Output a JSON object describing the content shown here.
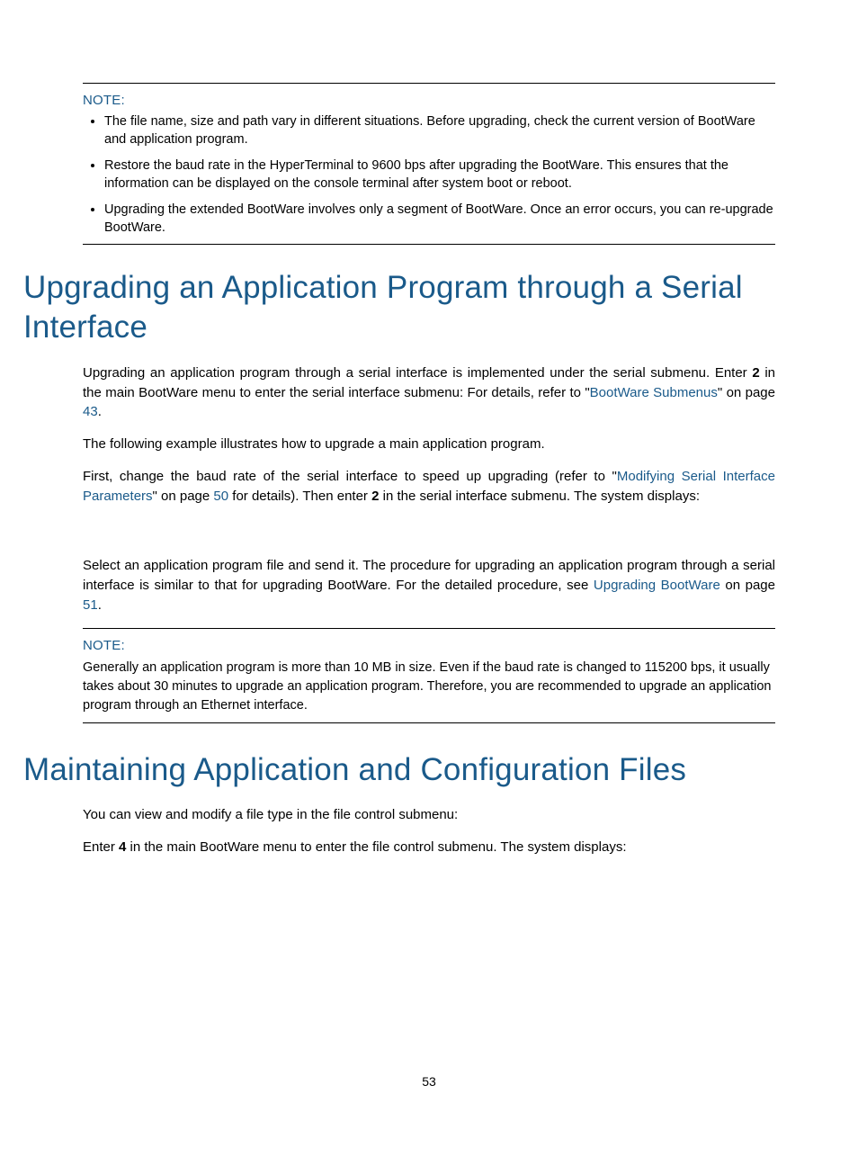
{
  "note1": {
    "label": "NOTE:",
    "items": [
      "The file name, size and path vary in different situations. Before upgrading, check the current version of BootWare and application program.",
      "Restore the baud rate in the HyperTerminal to 9600 bps after upgrading the BootWare. This ensures that the information can be displayed on the console terminal after system boot or reboot.",
      "Upgrading the extended BootWare involves only a segment of BootWare. Once an error occurs, you can re-upgrade BootWare."
    ]
  },
  "h1_upgrade": "Upgrading an Application Program through a Serial Interface",
  "para1": {
    "t1": "Upgrading an application program through a serial interface is implemented under the serial submenu. Enter ",
    "b1": "2",
    "t2": " in the main BootWare menu to enter the serial interface submenu: For details, refer to \"",
    "link1": "BootWare Submenus",
    "t3": "\" on page ",
    "link2": "43",
    "t4": "."
  },
  "para2": "The following example illustrates how to upgrade a main application program.",
  "para3": {
    "t1": "First, change the baud rate of the serial interface to speed up upgrading (refer to \"",
    "link1": "Modifying Serial Interface Parameters",
    "t2": "\" on page ",
    "link2": "50",
    "t3": " for details). Then enter ",
    "b1": "2",
    "t4": " in the serial interface submenu. The system displays:"
  },
  "para4": {
    "t1": "Select an application program file and send it. The procedure for upgrading an application program through a serial interface is similar to that for upgrading BootWare. For the detailed procedure, see ",
    "link1": "Upgrading BootWare",
    "t2": " on page ",
    "link2": "51",
    "t3": "."
  },
  "note2": {
    "label": "NOTE:",
    "text": "Generally an application program is more than 10 MB in size. Even if the baud rate is changed to 115200 bps, it usually takes about 30 minutes to upgrade an application program. Therefore, you are recommended to upgrade an application program through an Ethernet interface."
  },
  "h1_maint": "Maintaining Application and Configuration Files",
  "para5": "You can view and modify a file type in the file control submenu:",
  "para6": {
    "t1": "Enter ",
    "b1": "4",
    "t2": " in the main BootWare menu to enter the file control submenu. The system displays:"
  },
  "page_number": "53"
}
